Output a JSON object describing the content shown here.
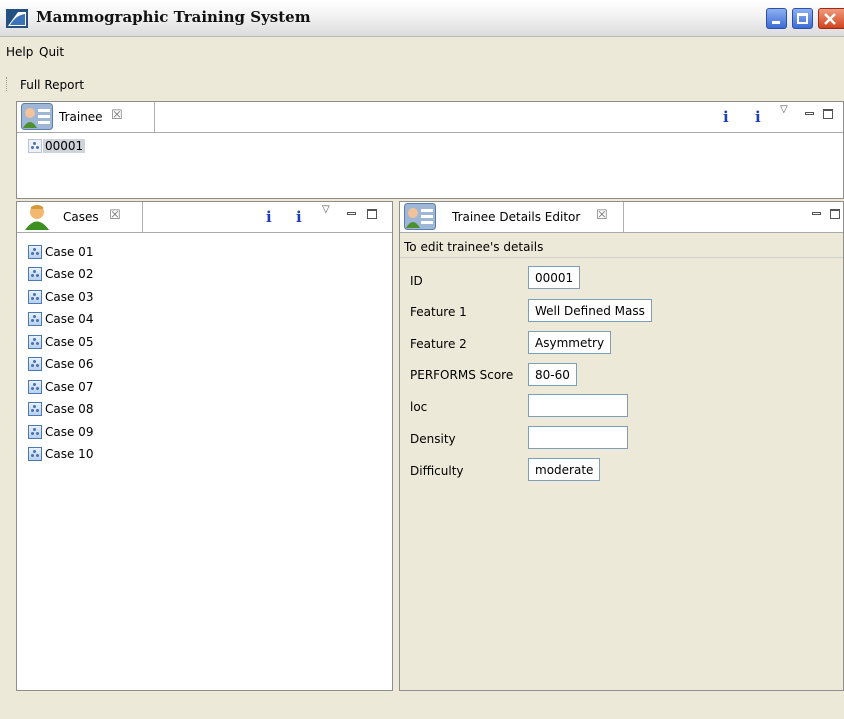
{
  "window": {
    "title": "Mammographic Training System",
    "icon": "app-logo-icon",
    "buttons": [
      "minimize-icon",
      "maximize-icon",
      "close-icon"
    ]
  },
  "menubar": {
    "items": [
      "Help",
      "Quit"
    ]
  },
  "toolbar": {
    "full_report": "Full Report"
  },
  "trainee_view": {
    "tab_label": "Trainee",
    "tab_close": "☒",
    "info_icon_1": "i",
    "info_icon_2": "i",
    "view_menu": "▽",
    "items": [
      "00001"
    ],
    "selected": "00001"
  },
  "cases_view": {
    "tab_label": "Cases",
    "tab_close": "☒",
    "info_icon_1": "i",
    "info_icon_2": "i",
    "view_menu": "▽",
    "items": [
      "Case 01",
      "Case 02",
      "Case 03",
      "Case 04",
      "Case 05",
      "Case 06",
      "Case 07",
      "Case 08",
      "Case 09",
      "Case 10"
    ]
  },
  "editor_view": {
    "tab_label": "Trainee Details Editor",
    "tab_close": "☒",
    "description": "To edit trainee's details",
    "fields": [
      {
        "label": "ID",
        "value": "00001"
      },
      {
        "label": "Feature 1",
        "value": "Well Defined Mass"
      },
      {
        "label": "Feature 2",
        "value": "Asymmetry"
      },
      {
        "label": "PERFORMS Score",
        "value": "80-60"
      },
      {
        "label": "loc",
        "value": ""
      },
      {
        "label": "Density",
        "value": ""
      },
      {
        "label": "Difficulty",
        "value": "moderate"
      }
    ]
  },
  "colors": {
    "background": "#ece9d8",
    "info_blue": "#1f3fb3",
    "selection": "#cfd3da"
  }
}
